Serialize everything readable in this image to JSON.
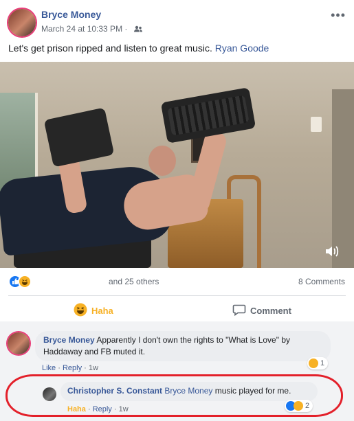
{
  "post": {
    "author": "Bryce Money",
    "timestamp": "March 24 at 10:33 PM · ",
    "privacy_icon": "friends-icon",
    "more_label": "•••",
    "text": "Let's get prison ripped and listen to great music. ",
    "tagged_person": "Ryan Goode"
  },
  "video": {
    "volume_icon": "speaker-icon"
  },
  "reactions": {
    "icons": [
      "like-icon",
      "haha-icon"
    ],
    "others_text": "and 25 others",
    "comments_count": "8 Comments"
  },
  "actions": {
    "haha_label": "Haha",
    "comment_label": "Comment"
  },
  "comments": [
    {
      "author": "Bryce Money",
      "text": " Apparently I don't own the rights to \"What is Love\" by Haddaway and FB muted it.",
      "like_label": "Like",
      "reply_label": "Reply",
      "age": "1w",
      "reaction_count": "1"
    },
    {
      "author": "Christopher S. Constant",
      "tag": "Bryce Money",
      "text": " music played for me.",
      "haha_label": "Haha",
      "reply_label": "Reply",
      "age": "1w",
      "reaction_count": "2"
    }
  ],
  "colors": {
    "link": "#385898",
    "haha": "#f7b125",
    "like": "#1877f2",
    "highlight": "#e3202a"
  }
}
